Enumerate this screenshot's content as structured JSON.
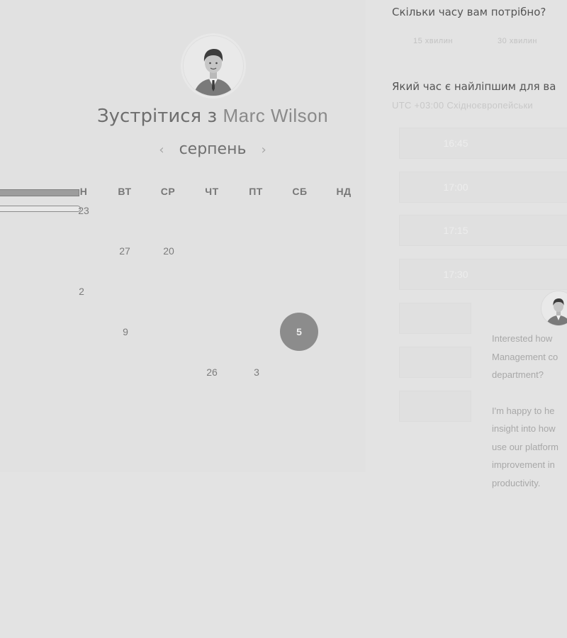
{
  "left": {
    "title_prefix": "Зустрітися з",
    "host_name": "Marc Wilson",
    "month": "серпень",
    "prev_icon": "‹",
    "next_icon": "›",
    "days_of_week": [
      "Н",
      "ВТ",
      "СР",
      "ЧТ",
      "ПТ",
      "СБ",
      "НД"
    ],
    "calendar": {
      "week1_partial": "23",
      "row2": [
        "27",
        "20"
      ],
      "row3": [
        "2"
      ],
      "row4": [
        "9"
      ],
      "selected_day": "5",
      "row5": [
        "26",
        "3"
      ]
    }
  },
  "right": {
    "duration_question": "Скільки часу вам потрібно?",
    "durations": [
      "15 хвилин",
      "30 хвилин"
    ],
    "time_question": "Який час є найліпшим для ва",
    "timezone": "UTC +03:00 Східноєвропейськи",
    "slots": [
      "16:45",
      "17:00",
      "17:15",
      "17:30"
    ],
    "popup": {
      "para1": [
        "Interested how",
        "Management co",
        "department?"
      ],
      "para2": [
        "I'm happy to he",
        "insight into how",
        "use our platform",
        "improvement in",
        "productivity."
      ]
    }
  }
}
